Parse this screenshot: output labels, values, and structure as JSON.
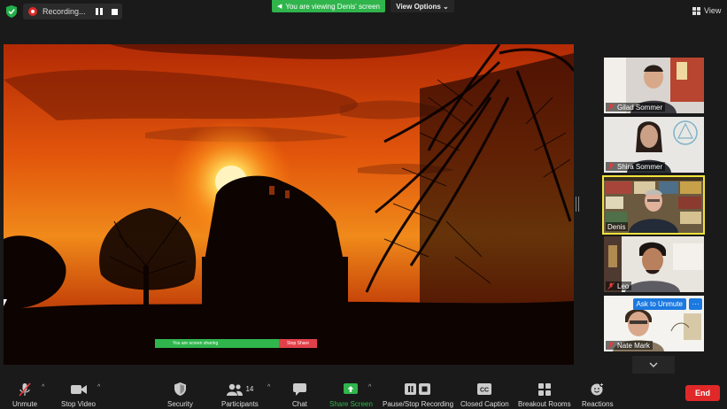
{
  "top_bar": {
    "recording_label": "Recording...",
    "viewing_banner": "You are viewing Denis' screen",
    "view_options_label": "View Options ⌄",
    "view_label": "View"
  },
  "shared_screen": {
    "sharing_bar_text": "You are screen sharing",
    "stop_share_text": "Stop Share"
  },
  "participants": [
    {
      "name": "Gilad Sommer",
      "muted": true
    },
    {
      "name": "Shira Sommer",
      "muted": true
    },
    {
      "name": "Denis",
      "muted": false,
      "active_speaker": true
    },
    {
      "name": "Leo",
      "muted": true
    },
    {
      "name": "Nate Mark",
      "muted": true,
      "ask_to_unmute": "Ask to Unmute",
      "more": "···"
    }
  ],
  "toolbar": {
    "unmute": "Unmute",
    "stop_video": "Stop Video",
    "security": "Security",
    "participants": "Participants",
    "participants_count": "14",
    "chat": "Chat",
    "share_screen": "Share Screen",
    "pause_stop_recording": "Pause/Stop Recording",
    "closed_caption": "Closed Caption",
    "breakout_rooms": "Breakout Rooms",
    "reactions": "Reactions",
    "end": "End"
  },
  "colors": {
    "accent_green": "#2fb54c",
    "active_speaker": "#f1e23a",
    "end_red": "#e02828",
    "ask_blue": "#1b79e0"
  }
}
